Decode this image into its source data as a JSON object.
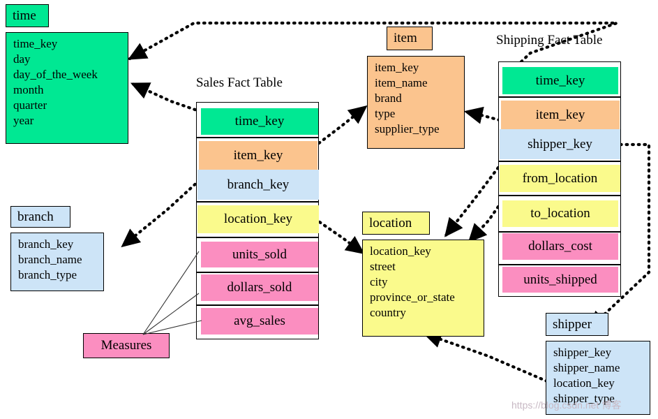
{
  "diagram": {
    "title_sales": "Sales Fact Table",
    "title_shipping": "Shipping Fact Table",
    "watermark": "https://blog.csdn.net 博客"
  },
  "colors": {
    "green": "#00E893",
    "orange": "#FBC48E",
    "blue": "#CDE4F7",
    "yellow": "#FAFA8C",
    "pink": "#FB8EC0",
    "white": "#FFFFFF",
    "outline": "#000000"
  },
  "dimensions": {
    "time": {
      "name": "time",
      "color_key": "green",
      "fields": [
        "time_key",
        "day",
        "day_of_the_week",
        "month",
        "quarter",
        "year"
      ]
    },
    "branch": {
      "name": "branch",
      "color_key": "blue",
      "fields": [
        "branch_key",
        "branch_name",
        "branch_type"
      ]
    },
    "item": {
      "name": "item",
      "color_key": "orange",
      "fields": [
        "item_key",
        "item_name",
        "brand",
        "type",
        "supplier_type"
      ]
    },
    "location": {
      "name": "location",
      "color_key": "yellow",
      "fields": [
        "location_key",
        "street",
        "city",
        "province_or_state",
        "country"
      ]
    },
    "shipper": {
      "name": "shipper",
      "color_key": "blue",
      "fields": [
        "shipper_key",
        "shipper_name",
        "location_key",
        "shipper_type"
      ]
    }
  },
  "facts": {
    "sales": {
      "title": "Sales Fact Table",
      "rows": [
        {
          "label": "time_key",
          "color_key": "green"
        },
        {
          "label": "item_key",
          "color_key": "orange"
        },
        {
          "label": "branch_key",
          "color_key": "blue"
        },
        {
          "label": "location_key",
          "color_key": "yellow"
        },
        {
          "label": "units_sold",
          "color_key": "pink"
        },
        {
          "label": "dollars_sold",
          "color_key": "pink"
        },
        {
          "label": "avg_sales",
          "color_key": "pink"
        }
      ]
    },
    "shipping": {
      "title": "Shipping Fact Table",
      "rows": [
        {
          "label": "time_key",
          "color_key": "green"
        },
        {
          "label": "item_key",
          "color_key": "orange"
        },
        {
          "label": "shipper_key",
          "color_key": "blue"
        },
        {
          "label": "from_location",
          "color_key": "yellow"
        },
        {
          "label": "to_location",
          "color_key": "yellow"
        },
        {
          "label": "dollars_cost",
          "color_key": "pink"
        },
        {
          "label": "units_shipped",
          "color_key": "pink"
        }
      ]
    }
  },
  "measures": {
    "label": "Measures",
    "color_key": "pink",
    "targets": [
      "units_sold",
      "dollars_sold",
      "avg_sales"
    ]
  },
  "relationships": [
    {
      "from": "sales.time_key",
      "to": "time"
    },
    {
      "from": "sales.item_key",
      "to": "item"
    },
    {
      "from": "sales.branch_key",
      "to": "branch"
    },
    {
      "from": "sales.location_key",
      "to": "location"
    },
    {
      "from": "shipping.time_key",
      "to": "time"
    },
    {
      "from": "shipping.item_key",
      "to": "item"
    },
    {
      "from": "shipping.shipper_key",
      "to": "shipper"
    },
    {
      "from": "shipping.from_location",
      "to": "location"
    },
    {
      "from": "shipping.to_location",
      "to": "location"
    },
    {
      "from": "shipper.location_key",
      "to": "location"
    }
  ]
}
